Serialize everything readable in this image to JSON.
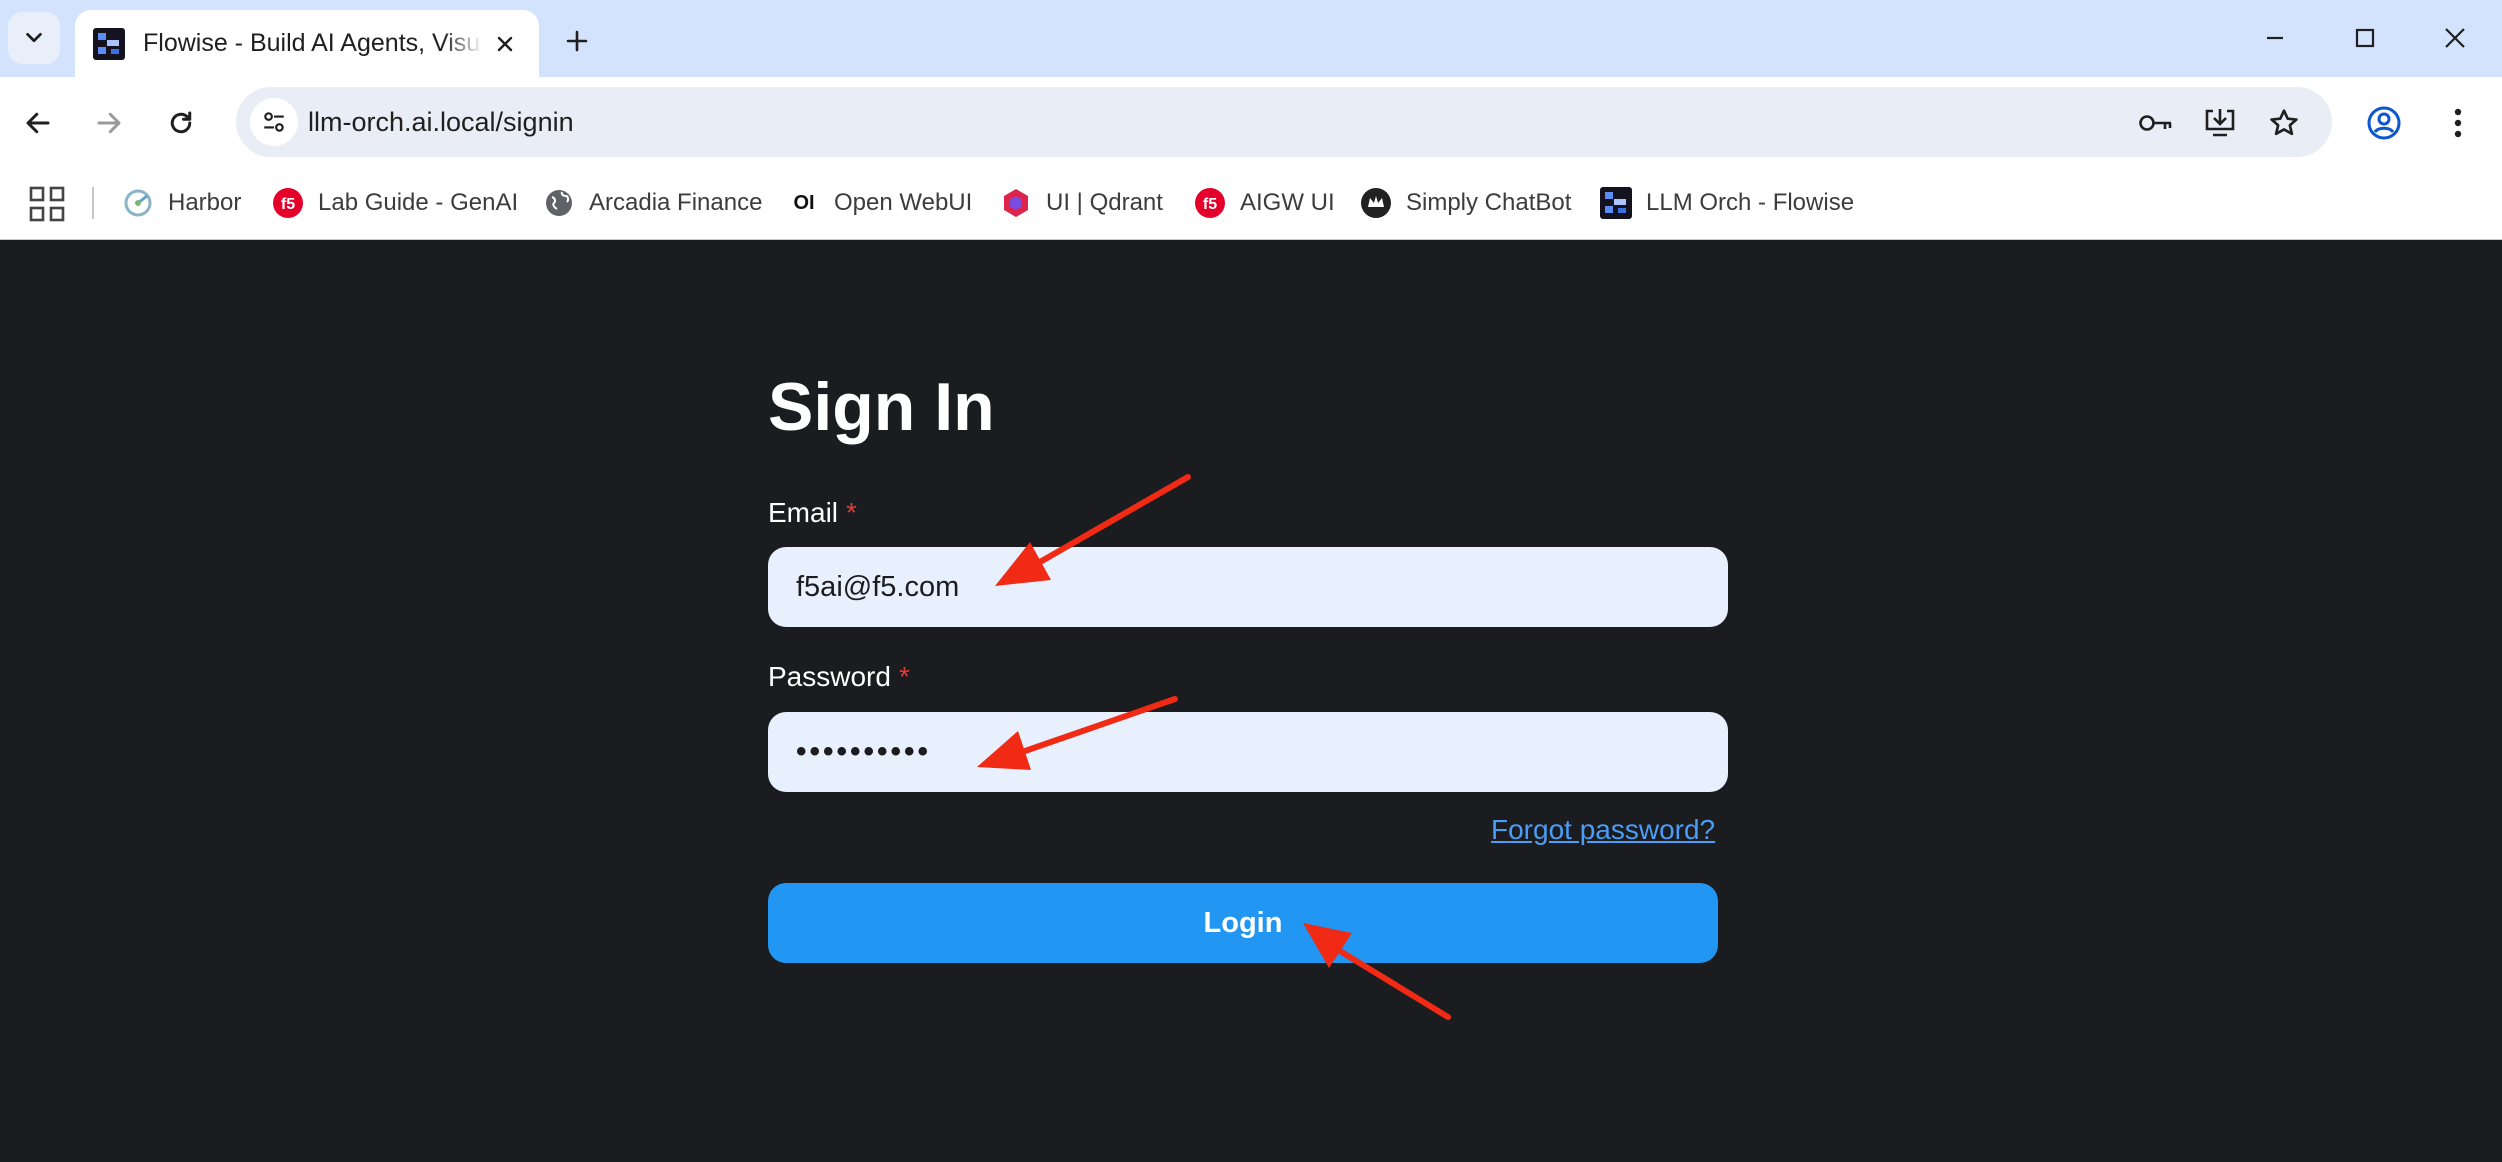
{
  "browser": {
    "tab": {
      "title": "Flowise - Build AI Agents, Visually"
    },
    "url": "llm-orch.ai.local/signin",
    "bookmarks": [
      {
        "label": "Harbor",
        "icon": "harbor-icon"
      },
      {
        "label": "Lab Guide - GenAI",
        "icon": "f5-icon"
      },
      {
        "label": "Arcadia Finance",
        "icon": "globe-icon"
      },
      {
        "label": "Open WebUI",
        "icon": "openwebui-icon"
      },
      {
        "label": "UI | Qdrant",
        "icon": "qdrant-icon"
      },
      {
        "label": "AIGW UI",
        "icon": "f5-icon"
      },
      {
        "label": "Simply ChatBot",
        "icon": "chatbot-icon"
      },
      {
        "label": "LLM Orch - Flowise",
        "icon": "flowise-icon"
      }
    ]
  },
  "signin": {
    "title": "Sign In",
    "email_label": "Email",
    "email_value": "f5ai@f5.com",
    "password_label": "Password",
    "password_value": "••••••••••",
    "required_marker": "*",
    "forgot_label": "Forgot password?",
    "login_label": "Login"
  },
  "colors": {
    "page_background": "#1b1c1f",
    "input_background": "#e8f0fe",
    "accent": "#2196f3",
    "link": "#4a9cf5",
    "required": "#e53935",
    "annotation_arrow": "#f02a14"
  },
  "annotations": [
    {
      "name": "arrow-to-email"
    },
    {
      "name": "arrow-to-password"
    },
    {
      "name": "arrow-to-login"
    }
  ]
}
